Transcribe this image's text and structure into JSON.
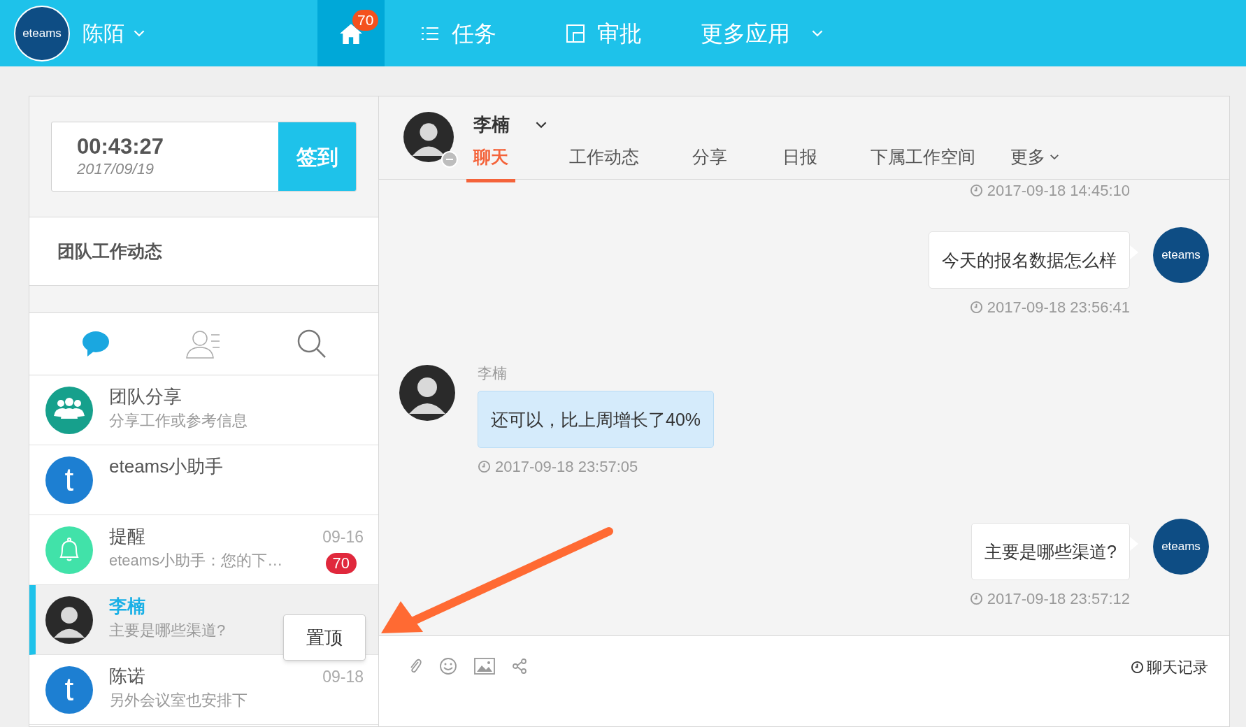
{
  "top_bar": {
    "logo_text": "eteams",
    "user_name": "陈陌",
    "home": {
      "badge": "70",
      "selected": true
    },
    "menu": [
      {
        "kind": "list",
        "label": "任务"
      },
      {
        "kind": "approval",
        "label": "审批"
      },
      {
        "kind": "dropdown",
        "label": "更多应用"
      }
    ]
  },
  "clock": {
    "time": "00:43:27",
    "date": "2017/09/19",
    "button": "签到"
  },
  "team_feed": "团队工作动态",
  "list_tabs": [
    {
      "kind": "chat",
      "selected": true
    },
    {
      "kind": "contacts",
      "selected": false
    },
    {
      "kind": "search",
      "selected": false
    }
  ],
  "conversations": [
    {
      "avatar": {
        "kind": "group"
      },
      "name": "团队分享",
      "preview": "分享工作或参考信息",
      "selected": false
    },
    {
      "avatar": {
        "kind": "letter",
        "text": "t"
      },
      "name": "eteams小助手",
      "selected": false
    },
    {
      "avatar": {
        "kind": "bell"
      },
      "name": "提醒",
      "preview": "eteams小助手：您的下…",
      "date": "09-16",
      "badge": "70",
      "selected": false
    },
    {
      "avatar": {
        "kind": "person"
      },
      "name": "李楠",
      "preview": "主要是哪些渠道?",
      "selected": true
    },
    {
      "avatar": {
        "kind": "letter",
        "text": "t"
      },
      "name": "陈诺",
      "preview": "另外会议室也安排下",
      "date": "09-18",
      "selected": false
    }
  ],
  "tooltip": "置顶",
  "chat": {
    "name": "李楠",
    "tabs": [
      {
        "label": "聊天",
        "selected": true
      },
      {
        "label": "工作动态",
        "selected": false
      },
      {
        "label": "分享",
        "selected": false
      },
      {
        "label": "日报",
        "selected": false
      },
      {
        "label": "下属工作空间",
        "selected": false
      },
      {
        "label": "更多",
        "selected": false,
        "dropdown": true
      }
    ],
    "messages": [
      {
        "kind": "timestamp",
        "time": "2017-09-18 14:45:10"
      },
      {
        "kind": "outgoing",
        "avatar_text": "eteams",
        "text": "今天的报名数据怎么样",
        "time": "2017-09-18 23:56:41"
      },
      {
        "kind": "incoming",
        "sender": "李楠",
        "text": "还可以，比上周增长了40%",
        "time": "2017-09-18 23:57:05"
      },
      {
        "kind": "outgoing",
        "avatar_text": "eteams",
        "text": "主要是哪些渠道?",
        "time": "2017-09-18 23:57:12"
      }
    ],
    "history": "聊天记录"
  }
}
